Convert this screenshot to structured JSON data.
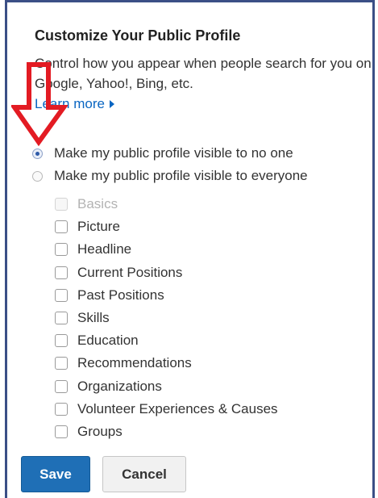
{
  "colors": {
    "frame_border": "#3b4f86",
    "link": "#0a66c2",
    "primary_button": "#1f6fb6",
    "annotation_arrow": "#e31b23"
  },
  "profile": {
    "title": "Customize Your Public Profile",
    "description": "Control how you appear when people search for you on Google, Yahoo!, Bing, etc.",
    "learn_more": "Learn more",
    "learn_more_icon": "caret-right-icon"
  },
  "visibility": {
    "options": [
      {
        "label": "Make my public profile visible to no one",
        "checked": true
      },
      {
        "label": "Make my public profile visible to everyone",
        "checked": false
      }
    ]
  },
  "sections": [
    {
      "label": "Basics",
      "checked": false,
      "disabled": true
    },
    {
      "label": "Picture",
      "checked": false,
      "disabled": false
    },
    {
      "label": "Headline",
      "checked": false,
      "disabled": false
    },
    {
      "label": "Current Positions",
      "checked": false,
      "disabled": false
    },
    {
      "label": "Past Positions",
      "checked": false,
      "disabled": false
    },
    {
      "label": "Skills",
      "checked": false,
      "disabled": false
    },
    {
      "label": "Education",
      "checked": false,
      "disabled": false
    },
    {
      "label": "Recommendations",
      "checked": false,
      "disabled": false
    },
    {
      "label": "Organizations",
      "checked": false,
      "disabled": false
    },
    {
      "label": "Volunteer Experiences & Causes",
      "checked": false,
      "disabled": false
    },
    {
      "label": "Groups",
      "checked": false,
      "disabled": false
    }
  ],
  "actions": {
    "save": "Save",
    "cancel": "Cancel"
  }
}
